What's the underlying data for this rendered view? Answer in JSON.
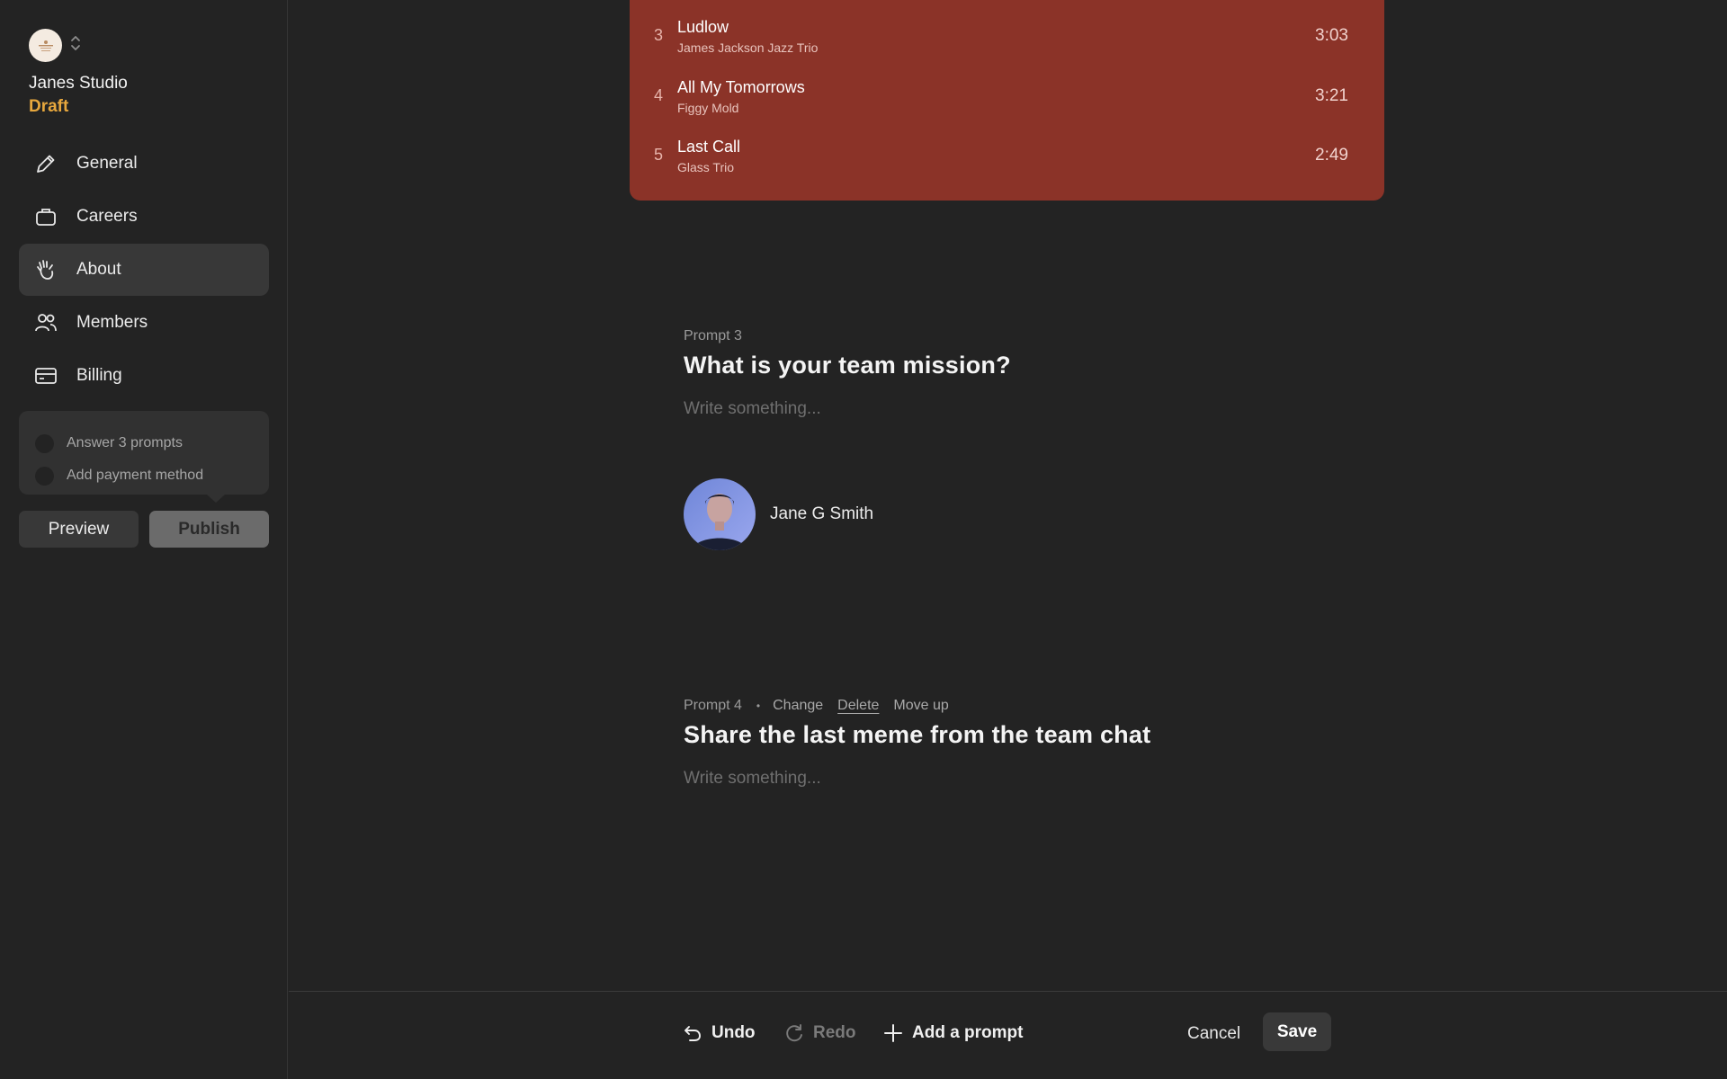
{
  "sidebar": {
    "org_name": "Janes Studio",
    "org_status": "Draft",
    "logo_icon": "studio-logo-icon",
    "switch_icon": "chevron-up-down-icon",
    "nav": [
      {
        "label": "General",
        "icon": "pencil-icon",
        "active": false
      },
      {
        "label": "Careers",
        "icon": "briefcase-icon",
        "active": false
      },
      {
        "label": "About",
        "icon": "waving-hand-icon",
        "active": true
      },
      {
        "label": "Members",
        "icon": "people-icon",
        "active": false
      },
      {
        "label": "Billing",
        "icon": "credit-card-icon",
        "active": false
      }
    ],
    "checklist": [
      {
        "label": "Answer 3 prompts",
        "done": false
      },
      {
        "label": "Add payment method",
        "done": false
      }
    ],
    "preview_label": "Preview",
    "publish_label": "Publish"
  },
  "playlist": {
    "color": "#8b3328",
    "tracks": [
      {
        "num": "3",
        "title": "Ludlow",
        "artist": "James Jackson Jazz Trio",
        "duration": "3:03"
      },
      {
        "num": "4",
        "title": "All My Tomorrows",
        "artist": "Figgy Mold",
        "duration": "3:21"
      },
      {
        "num": "5",
        "title": "Last Call",
        "artist": "Glass Trio",
        "duration": "2:49"
      }
    ]
  },
  "prompt3": {
    "meta": "Prompt 3",
    "title": "What is your team mission?",
    "placeholder": "Write something...",
    "author_name": "Jane G Smith"
  },
  "prompt4": {
    "meta": "Prompt 4",
    "separator": "•",
    "actions": {
      "change": "Change",
      "delete": "Delete",
      "move_up": "Move up"
    },
    "title": "Share the last meme from the team chat",
    "placeholder": "Write something..."
  },
  "bottombar": {
    "undo": "Undo",
    "redo": "Redo",
    "add_prompt": "Add a prompt",
    "cancel": "Cancel",
    "save": "Save"
  },
  "colors": {
    "background": "#232323",
    "accent_draft": "#e7a73d",
    "active_nav": "#383838"
  }
}
